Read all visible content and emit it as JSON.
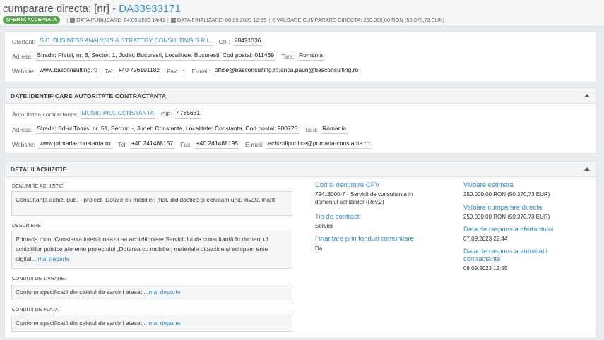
{
  "header": {
    "title_prefix": "cumparare directa: [nr] - ",
    "title_id": "DA33933171",
    "status_badge": "OFERTA ACCEPTATA",
    "publish_label": "DATA PUBLICARE:",
    "publish_value": "04.09.2023 14:41",
    "final_label": "DATA FINALIZARE:",
    "final_value": "08.09.2023 12:55",
    "value_label": "VALOARE CUMPARARE DIRECTA:",
    "value_value": "250.000,00 RON (50.370,73 EUR)"
  },
  "offerer": {
    "ofertant_label": "Ofertant:",
    "ofertant_value": "S.C. BUSINESS ANALYSIS & STRATEGY CONSULTING S.R.L.",
    "cif_label": "CIF:",
    "cif_value": "28421336",
    "adresa_label": "Adresa:",
    "adresa_value": "Strada: Pietei, nr. 6, Sector: 1, Judet: Bucuresti, Localitate: Bucuresti, Cod postal: 011469",
    "tara_label": "Tara:",
    "tara_value": "Romania",
    "website_label": "Website:",
    "website_value": "www.basconsulting.ro",
    "tel_label": "Tel:",
    "tel_value": "+40 726191182",
    "fax_label": "Fax:",
    "fax_value": "-",
    "email_label": "E-mail:",
    "email_value": "office@basconsulting.ro;anca.paun@basconsulting.ro"
  },
  "authority": {
    "section_title": "DATE IDENTIFICARE AUTORITATE CONTRACTANTA",
    "autoritate_label": "Autoritatea contractanta:",
    "autoritate_value": "MUNICIPIUL CONSTANTA",
    "cif_label": "CIF:",
    "cif_value": "4785631",
    "adresa_label": "Adresa:",
    "adresa_value": "Strada: Bd-ul Tomis, nr. 51, Sector: -, Judet: Constanta, Localitate: Constanta, Cod postal: 900725",
    "tara_label": "Tara:",
    "tara_value": "Romania",
    "website_label": "Website:",
    "website_value": "www.primaria-constanta.ro",
    "tel_label": "Tel:",
    "tel_value": "+40 241488157",
    "fax_label": "Fax:",
    "fax_value": "+40 241488195",
    "email_label": "E-mail:",
    "email_value": "achizitiipublice@primaria-constanta.ro"
  },
  "details": {
    "section_title": "DETALII ACHIZITIE",
    "denumire_label": "DENUMIRE ACHIZITIE",
    "denumire_value": "Consultanţă achiz. pub. - proiect- Dotare cu mobilier, mat. dididactice şi echipam unit. invata mant",
    "descriere_label": "DESCRIERE",
    "descriere_value": "Primaria mun. Constanta intentioneaza sa achizitioneze Serviciului de consultanţă în domeni ul achiziţiilor publice aferente proiectului „Dotarea cu mobilier, materiale didactice şi echipam ente digital...",
    "livrare_label": "CONDITII DE LIVRARE:",
    "livrare_value": "Conform specificatii din caietul de sarcini atasat...",
    "plata_label": "CONDITII DE PLATA:",
    "plata_value": "Conform specificatii din caietul de sarcini atasat...",
    "more_link": "mai departe",
    "cpv_label": "Cod si denumire CPV",
    "cpv_value": "79418000-7 - Servicii de consultanta in domeniul achizitiilor (Rev.2)",
    "tip_label": "Tip de contract",
    "tip_value": "Servicii",
    "fonduri_label": "Finantare prin fonduri comunitare",
    "fonduri_value": "Da",
    "estimata_label": "Valoare estimata",
    "estimata_value": "250.000,00 RON (50.370,73 EUR)",
    "cumparare_label": "Valoare cumparare directa",
    "cumparare_value": "250.000,00 RON (50.370,73 EUR)",
    "raspuns_ofertant_label": "Data de raspuns a ofertantului",
    "raspuns_ofertant_value": "07.09.2023 22:44",
    "raspuns_autoritate_label": "Data de raspuns a autoritatii contractante",
    "raspuns_autoritate_value": "08.09.2023 12:55"
  }
}
